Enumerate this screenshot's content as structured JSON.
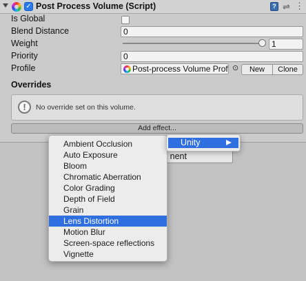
{
  "component": {
    "title": "Post Process Volume (Script)",
    "enabled": true
  },
  "fields": {
    "is_global": {
      "label": "Is Global",
      "checked": false
    },
    "blend_distance": {
      "label": "Blend Distance",
      "value": "0"
    },
    "weight": {
      "label": "Weight",
      "value": "1",
      "slider_fraction": 1.0
    },
    "priority": {
      "label": "Priority",
      "value": "0"
    },
    "profile": {
      "label": "Profile",
      "value": "Post-process Volume Prof",
      "new_label": "New",
      "clone_label": "Clone"
    }
  },
  "overrides": {
    "title": "Overrides",
    "info_text": "No override set on this volume.",
    "add_effect_label": "Add effect..."
  },
  "behind_button": {
    "label": "nent"
  },
  "context_menu": {
    "items": [
      "Ambient Occlusion",
      "Auto Exposure",
      "Bloom",
      "Chromatic Aberration",
      "Color Grading",
      "Depth of Field",
      "Grain",
      "Lens Distortion",
      "Motion Blur",
      "Screen-space reflections",
      "Vignette"
    ],
    "selected_index": 7
  },
  "submenu": {
    "label": "Unity"
  },
  "icons": {
    "foldout": "foldout-arrow-icon",
    "component": "post-process-volume-icon",
    "help": "help-book-icon",
    "settings": "preset-settings-icon",
    "menu": "component-menu-icon",
    "info": "info-icon",
    "picker": "object-picker-icon"
  },
  "colors": {
    "selection": "#2f6fe0",
    "inspector_bg": "#cbcbcb"
  }
}
